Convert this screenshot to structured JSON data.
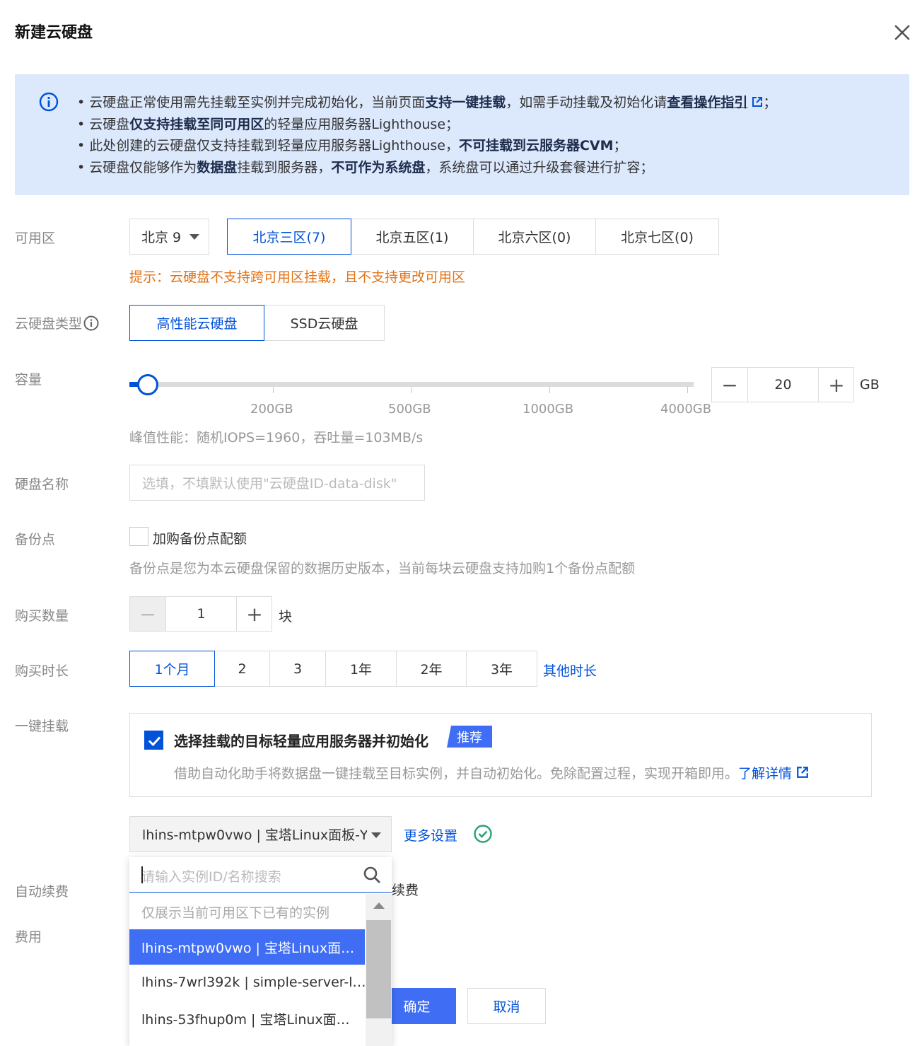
{
  "dialog": {
    "title": "新建云硬盘"
  },
  "notice": {
    "line1": {
      "bullet": "•",
      "p1": "云硬盘正常使用需先挂载至实例并完成初始化，当前页面",
      "b1": "支持一键挂载",
      "p2": "，如需手动挂载及初始化请",
      "link": "查看操作指引",
      "p3": "；"
    },
    "line2": {
      "bullet": "•",
      "p1": "云硬盘",
      "b1": "仅支持挂载至同可用区",
      "p2": "的轻量应用服务器Lighthouse；"
    },
    "line3": {
      "bullet": "•",
      "p1": "此处创建的云硬盘仅支持挂载到轻量应用服务器Lighthouse，",
      "b1": "不可挂载到云服务器CVM",
      "p2": "；"
    },
    "line4": {
      "bullet": "•",
      "p1": "云硬盘仅能够作为",
      "b1": "数据盘",
      "p2": "挂载到服务器，",
      "b2": "不可作为系统盘",
      "p3": "，系统盘可以通过升级套餐进行扩容；"
    }
  },
  "zone": {
    "label": "可用区",
    "region": "北京 9",
    "options": [
      "北京三区(7)",
      "北京五区(1)",
      "北京六区(0)",
      "北京七区(0)"
    ],
    "selected": "北京三区(7)",
    "tip": "提示：云硬盘不支持跨可用区挂载，且不支持更改可用区"
  },
  "disk_type": {
    "label": "云硬盘类型",
    "options": [
      "高性能云硬盘",
      "SSD云硬盘"
    ],
    "selected": "高性能云硬盘"
  },
  "capacity": {
    "label": "容量",
    "ticks": [
      "200GB",
      "500GB",
      "1000GB",
      "4000GB"
    ],
    "value": "20",
    "value_fraction": 0.0,
    "unit": "GB",
    "minus": "−",
    "plus": "+",
    "perf": "峰值性能：随机IOPS=1960，吞吐量=103MB/s"
  },
  "disk_name": {
    "label": "硬盘名称",
    "placeholder": "选填，不填默认使用\"云硬盘ID-data-disk\""
  },
  "backup": {
    "label": "备份点",
    "checkbox_label": "加购备份点配额",
    "checked": false,
    "hint": "备份点是您为本云硬盘保留的数据历史版本，当前每块云硬盘支持加购1个备份点配额"
  },
  "quantity": {
    "label": "购买数量",
    "value": "1",
    "unit": "块",
    "minus": "−",
    "plus": "+"
  },
  "duration": {
    "label": "购买时长",
    "options": [
      "1个月",
      "2",
      "3",
      "1年",
      "2年",
      "3年"
    ],
    "selected": "1个月",
    "other": "其他时长"
  },
  "attach": {
    "label": "一键挂载",
    "checked": true,
    "title": "选择挂载的目标轻量应用服务器并初始化",
    "badge": "推荐",
    "desc": "借助自动化助手将数据盘一键挂载至目标实例，并自动初始化。免除配置过程，实现开箱即用。",
    "learn_more": "了解详情",
    "instance": "lhins-mtpw0vwo | 宝塔Linux面板-Y\\",
    "more_settings": "更多设置"
  },
  "dropdown": {
    "search_placeholder": "请输入实例ID/名称搜索",
    "note": "仅展示当前可用区下已有的实例",
    "items": [
      "lhins-mtpw0vwo | 宝塔Linux面…",
      "lhins-7wrl392k | simple-server-l…",
      "lhins-53fhup0m | 宝塔Linux面…"
    ],
    "selected_index": 0
  },
  "auto_renew": {
    "label": "自动续费",
    "partial_text": "续费"
  },
  "fee": {
    "label": "费用"
  },
  "footer": {
    "ok": "确定",
    "cancel": "取消"
  },
  "colors": {
    "primary": "#0052d9",
    "accent": "#3f6ef5",
    "notice_bg": "#dce8fc",
    "warning": "#e37318",
    "success": "#2ba471"
  }
}
